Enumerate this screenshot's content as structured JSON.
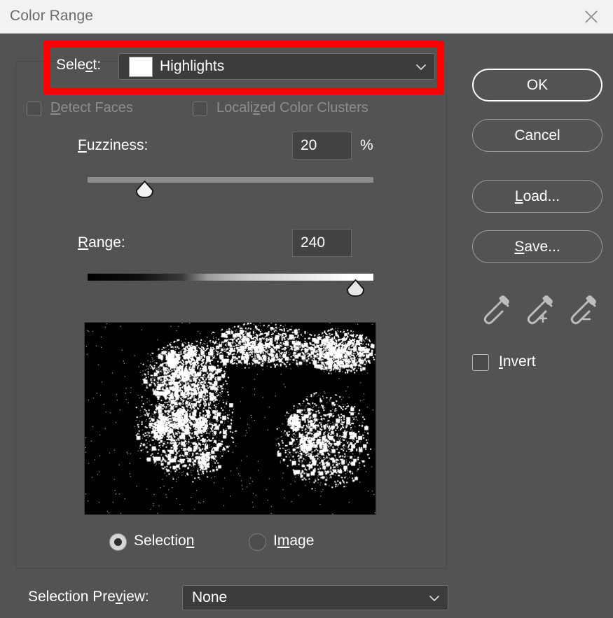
{
  "window": {
    "title": "Color Range",
    "close_icon": "close-icon"
  },
  "select_row": {
    "label": "Select:",
    "value": "Highlights",
    "swatch_color": "#ffffff",
    "caret_icon": "chevron-down-icon",
    "options": [
      "Highlights"
    ]
  },
  "checkboxes": {
    "detect_faces": {
      "label": "Detect Faces",
      "checked": false,
      "enabled": false
    },
    "localized_color_clusters": {
      "label": "Localized Color Clusters",
      "checked": false,
      "enabled": false
    }
  },
  "fuzziness": {
    "label": "Fuzziness:",
    "value": "20",
    "unit": "%",
    "slider_percent": 18
  },
  "range": {
    "label": "Range:",
    "value": "240",
    "slider_percent": 92
  },
  "preview": {
    "mode_icon": "selection-mask-preview",
    "description": "Black and white selection mask of tree foliage highlights"
  },
  "preview_mode": {
    "selection": {
      "label": "Selection",
      "selected": true
    },
    "image": {
      "label": "Image",
      "selected": false
    }
  },
  "selection_preview": {
    "label": "Selection Preview:",
    "value": "None",
    "caret_icon": "chevron-down-icon",
    "options": [
      "None"
    ]
  },
  "buttons": {
    "ok": "OK",
    "cancel": "Cancel",
    "load": "Load...",
    "save": "Save..."
  },
  "eyedroppers": [
    {
      "name": "eyedropper-icon",
      "title": "Eyedropper Tool"
    },
    {
      "name": "eyedropper-plus-icon",
      "title": "Add to Sample"
    },
    {
      "name": "eyedropper-minus-icon",
      "title": "Subtract from Sample"
    }
  ],
  "invert": {
    "label": "Invert",
    "checked": false
  },
  "annotation": {
    "highlight_color": "#fe0000",
    "target": "select-row"
  },
  "colors": {
    "dialog_bg": "#535353",
    "titlebar_bg": "#f2f2f2",
    "title_text": "#6b6b6b",
    "field_bg": "#3c3c3c",
    "text": "#ffffff",
    "disabled_text": "#8d8d8d"
  }
}
